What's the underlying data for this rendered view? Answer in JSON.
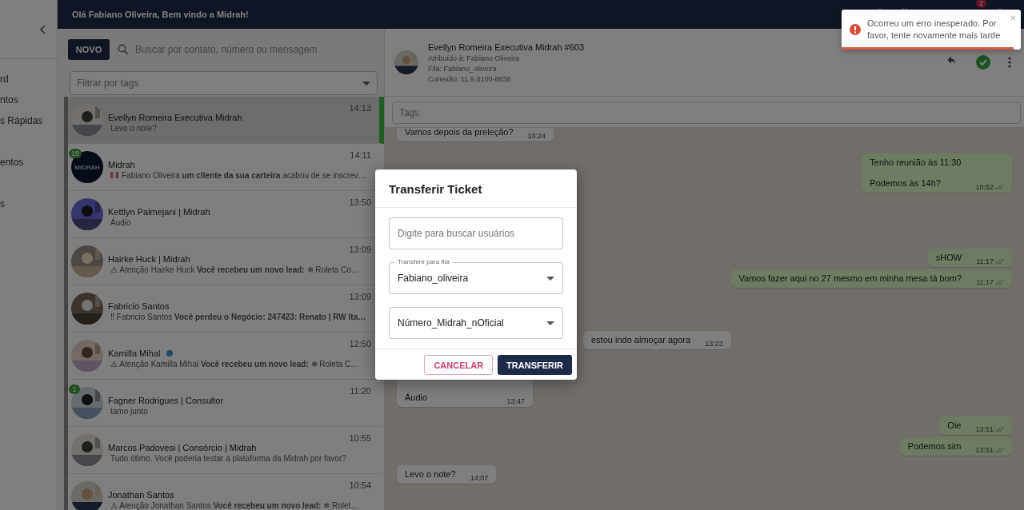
{
  "header": {
    "greeting": "Olá Fabiano Oliveira, Bem vindo a Midrah!",
    "notification_count": "2"
  },
  "sidebar": {
    "items": [
      {
        "label": "rd"
      },
      {
        "label": "ntos"
      },
      {
        "label": "s Rápidas"
      },
      {
        "label": "entos"
      },
      {
        "label": "s"
      }
    ]
  },
  "ticket_list": {
    "new_button": "NOVO",
    "search": {
      "placeholder": "Buscar por contato, número ou mensagem"
    },
    "tag_filter": {
      "placeholder": "Filtrar por tags"
    },
    "tickets": [
      {
        "name": "Evellyn Romeira Executiva Midrah",
        "preview": "Levo o note?",
        "time": "14:13",
        "selected": true
      },
      {
        "name": "Midrah",
        "preview": "Fabiano Oliveira **um cliente da sua carteira** acabou de se inscrev…",
        "time": "14:11",
        "selected": false,
        "unread": "19",
        "avatar_text": "MIDRAH",
        "flag": true
      },
      {
        "name": "Kettlyn Palmejani | Midrah",
        "preview": "Áudio",
        "time": "13:50",
        "selected": false
      },
      {
        "name": "Hairke Huck | Midrah",
        "preview": "⚠ Atenção Hairke Huck **Você recebeu um novo lead:** ❄ Roleta Co…",
        "time": "13:09",
        "selected": false
      },
      {
        "name": "Fabricio Santos",
        "preview": "‼ Fabricio Santos **Você perdeu o Negócio: 247423: Renato | RW Ita…**",
        "time": "13:09",
        "selected": false
      },
      {
        "name": "Kamilla Mihal",
        "preview": "⚠ Atenção Kamilla Mihal **Você recebeu um novo lead:** ❄ Roleta C…",
        "time": "12:50",
        "selected": false,
        "online": true
      },
      {
        "name": "Fagner Rodrigues | Consultor",
        "preview": "tamo junto",
        "time": "11:20",
        "selected": false,
        "unread": "1"
      },
      {
        "name": "Marcos Padovesi | Consórcio | Midrah",
        "preview": "Tudo ótimo. Você poderia testar a plataforma da Midrah por favor?",
        "time": "10:55",
        "selected": false
      },
      {
        "name": "Jonathan Santos",
        "preview": "⚠ Atenção Jonathan Santos **Você recebeu um novo lead:** ❄ Rolet…",
        "time": "10:54",
        "selected": false
      }
    ]
  },
  "chat": {
    "title": "Evellyn Romeira Executiva Midrah #603",
    "assigned": "Atribuído à: Fabiano Oliveira",
    "queue": "Fila: Fabiano_oliveira",
    "connection": "Conexão: 11.9.8100-8838",
    "tags": {
      "placeholder": "Tags"
    },
    "messages": [
      {
        "from_me": false,
        "text": "Vamos depois da preleção?",
        "time": "10:24"
      },
      {
        "from_me": true,
        "text": "Tenho reunião às 11:30\n\nPodemos às 14h?",
        "time": "10:52"
      },
      {
        "from_me": true,
        "text": "sHOW",
        "time": "11:17"
      },
      {
        "from_me": true,
        "text": "Vamos fazer aqui no 27 mesmo em minha mesa tá bom?",
        "time": "11:17"
      },
      {
        "from_me": false,
        "text": "estou indo almoçar agora",
        "time": "13:23"
      },
      {
        "from_me": false,
        "text": "Áudio",
        "time": "13:47"
      },
      {
        "from_me": true,
        "text": "Oie",
        "time": "13:51"
      },
      {
        "from_me": true,
        "text": "Podemos sim",
        "time": "13:51"
      },
      {
        "from_me": false,
        "text": "Levo o note?",
        "time": "14:07"
      }
    ]
  },
  "dialog": {
    "title": "Transferir Ticket",
    "user_search": {
      "placeholder": "Digite para buscar usuários"
    },
    "queue_select": {
      "label": "Transferir para fila",
      "value": "Fabiano_oliveira"
    },
    "connection_select": {
      "value": "Número_Midrah_nOficial"
    },
    "buttons": [
      {
        "label": "CANCELAR",
        "kind": "cancel"
      },
      {
        "label": "TRANSFERIR",
        "kind": "primary"
      }
    ]
  },
  "toast": {
    "message": "Ocorreu um erro inesperado. Por favor, tente novamente mais tarde",
    "close": "×",
    "level": 0.96
  }
}
